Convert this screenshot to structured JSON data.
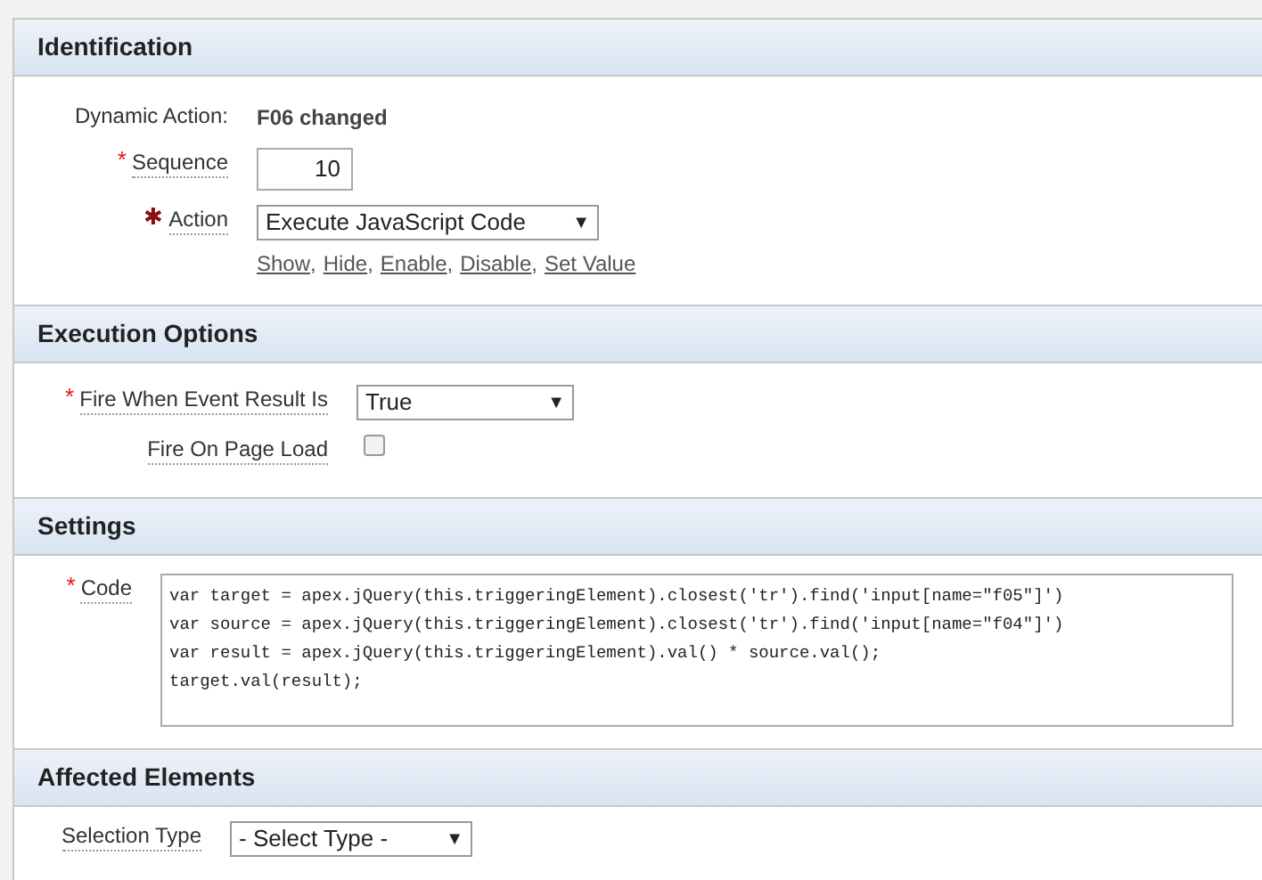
{
  "sections": [
    {
      "title": "Identification",
      "fields": [
        {
          "kind": "display",
          "label": "Dynamic Action:",
          "value": "F06 changed"
        },
        {
          "kind": "text",
          "label": "Sequence",
          "required": "*",
          "value": "10"
        },
        {
          "kind": "select",
          "label": "Action",
          "required": "✱",
          "value": "Execute JavaScript Code",
          "arrow": "▼",
          "links": [
            "Show",
            "Hide",
            "Enable",
            "Disable",
            "Set Value"
          ],
          "link_separator": ","
        }
      ]
    },
    {
      "title": "Execution Options",
      "fields": [
        {
          "kind": "select",
          "label": "Fire When Event Result Is",
          "required": "*",
          "value": "True",
          "arrow": "▼"
        },
        {
          "kind": "checkbox",
          "label": "Fire On Page Load",
          "checked": false
        }
      ]
    },
    {
      "title": "Settings",
      "fields": [
        {
          "kind": "textarea",
          "label": "Code",
          "required": "*",
          "lines": [
            "var target = apex.jQuery(this.triggeringElement).closest('tr').find('input[name=\"f05\"]')",
            "var source = apex.jQuery(this.triggeringElement).closest('tr').find('input[name=\"f04\"]')",
            "var result = apex.jQuery(this.triggeringElement).val() * source.val();",
            "target.val(result);"
          ]
        }
      ]
    },
    {
      "title": "Affected Elements",
      "fields": [
        {
          "kind": "select",
          "label": "Selection Type",
          "value": "- Select Type -",
          "arrow": "▼"
        }
      ]
    }
  ]
}
